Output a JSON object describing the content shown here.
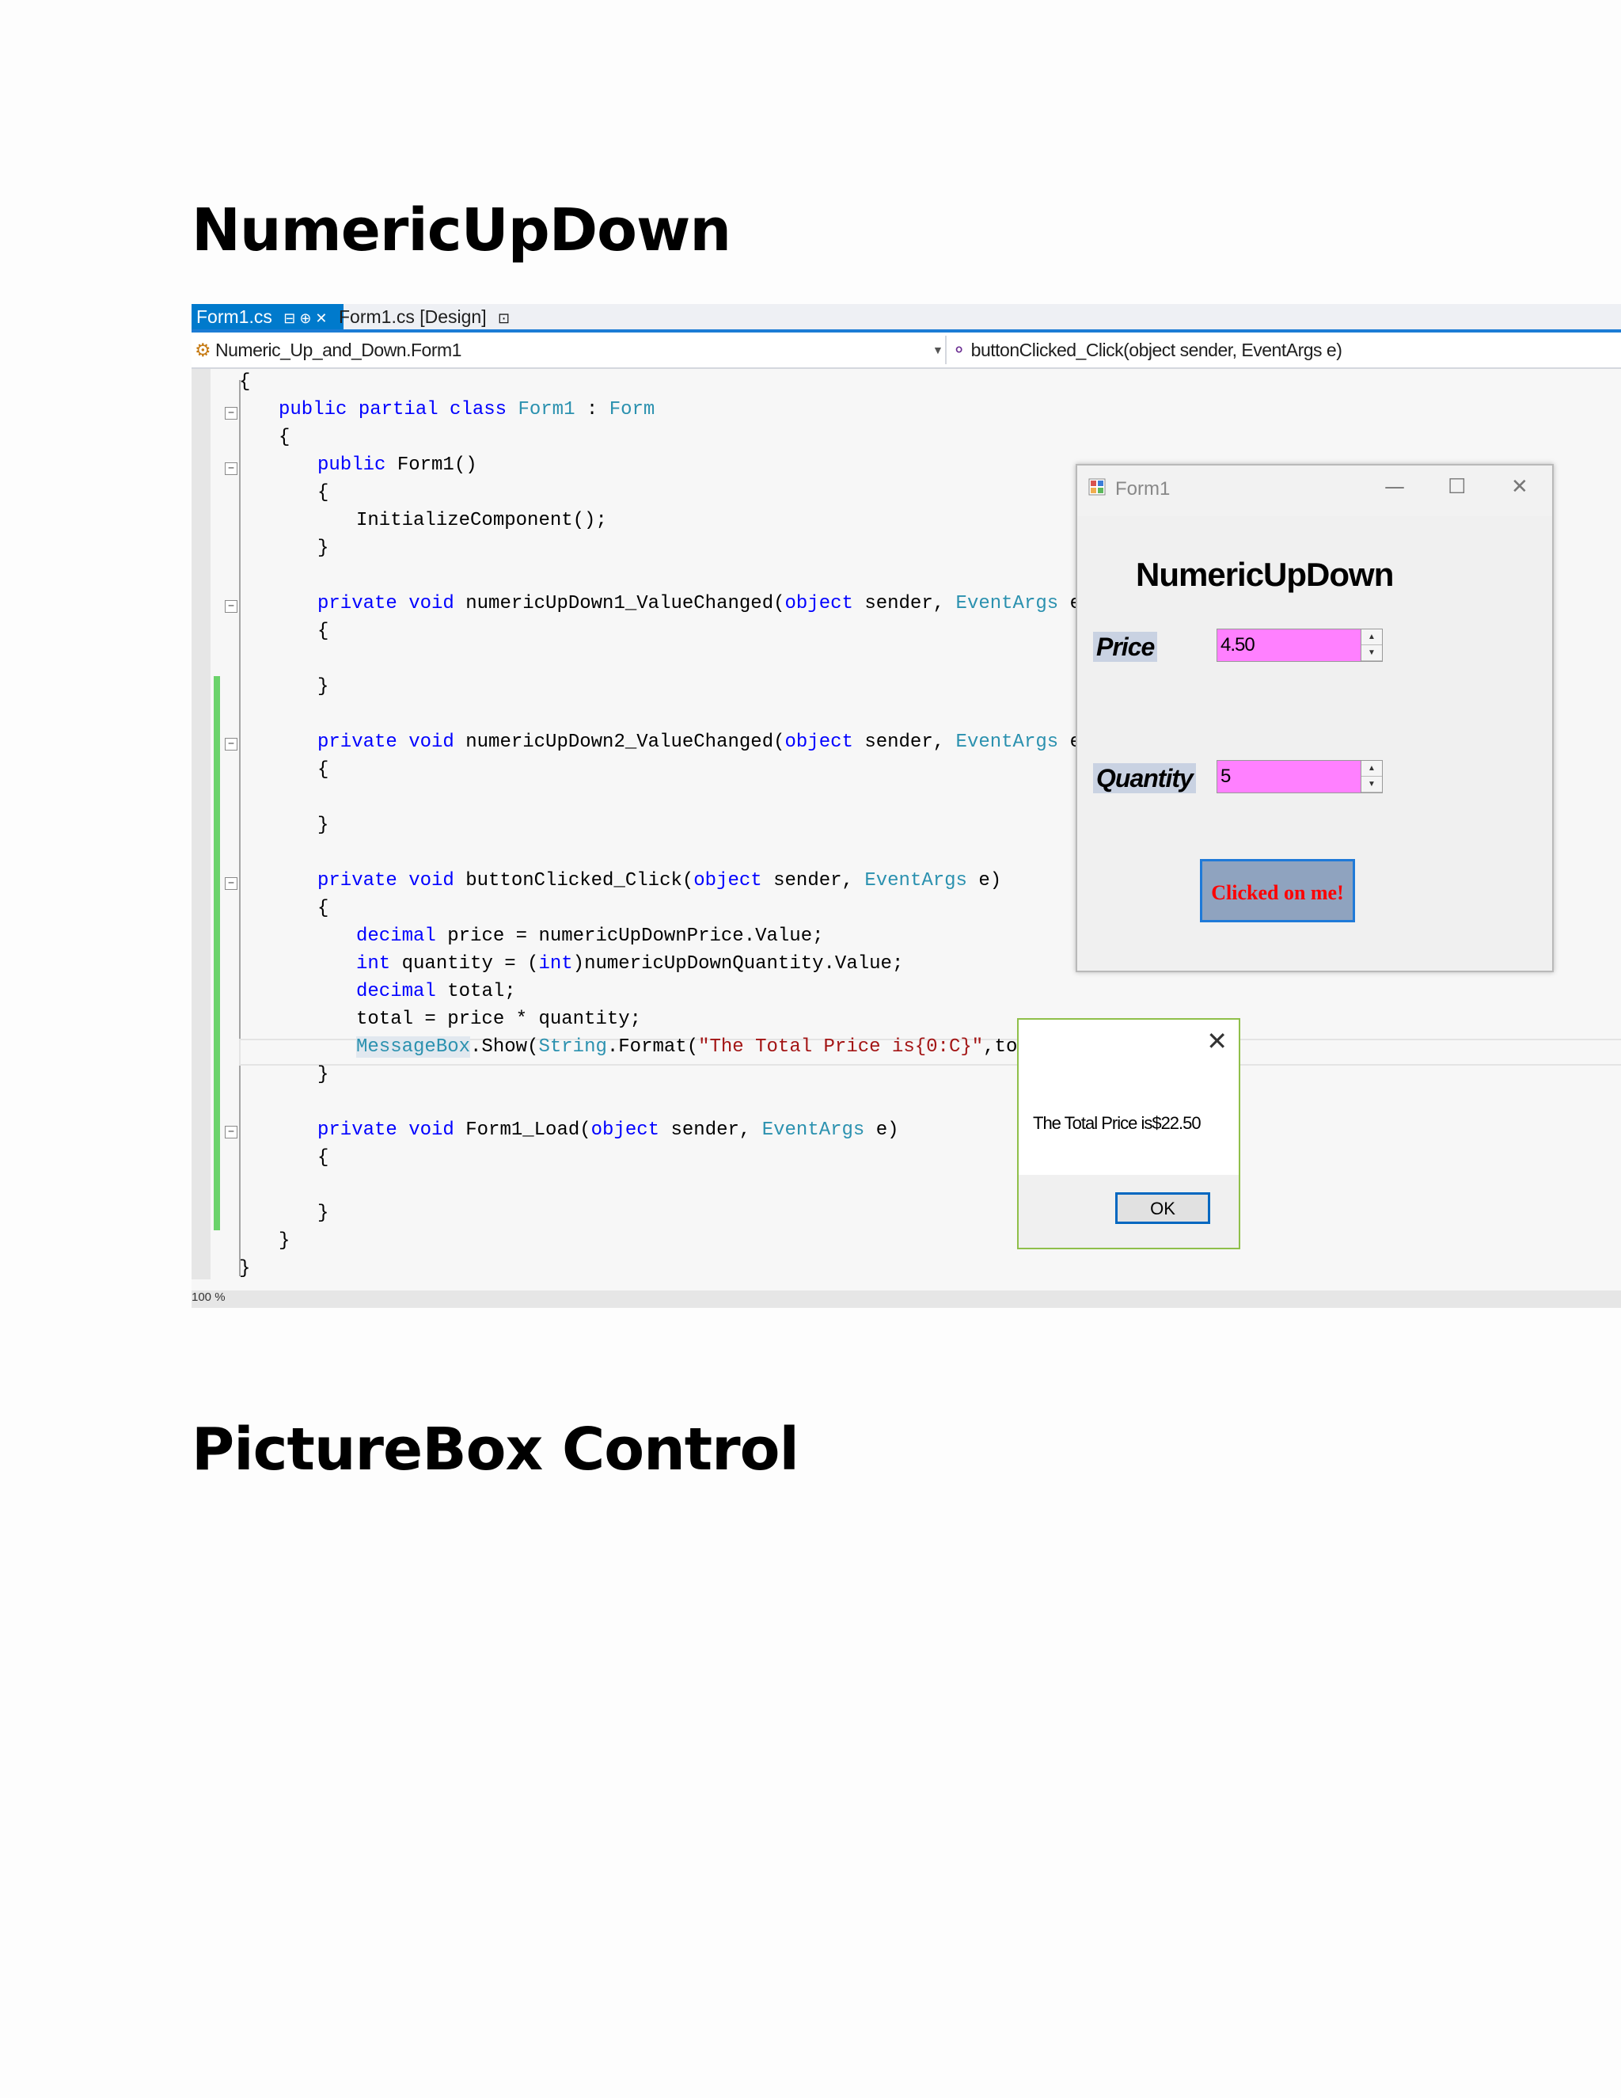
{
  "headings": {
    "section1": "NumericUpDown",
    "section2": "PictureBox Control"
  },
  "ide": {
    "tabs": [
      {
        "label": "Form1.cs",
        "icons": "⊟ ⊕ ✕"
      },
      {
        "label": "Form1.cs [Design]",
        "icons": "🔒"
      }
    ],
    "nav_left": "Numeric_Up_and_Down.Form1",
    "nav_right": "buttonClicked_Click(object sender, EventArgs e)",
    "zoom": "100 %"
  },
  "form1": {
    "title": "Form1",
    "heading": "NumericUpDown",
    "price_label": "Price",
    "price_value": "4.50",
    "quantity_label": "Quantity",
    "quantity_value": "5",
    "button_label": "Clicked on me!"
  },
  "messagebox": {
    "text": "The Total Price is$22.50",
    "ok_label": "OK"
  },
  "colors": {
    "accent": "#007acc",
    "keyword": "#0000ff",
    "type": "#2b91af",
    "string": "#a31515",
    "updown_bg": "#ff80ff",
    "button_text": "#ff0000"
  }
}
